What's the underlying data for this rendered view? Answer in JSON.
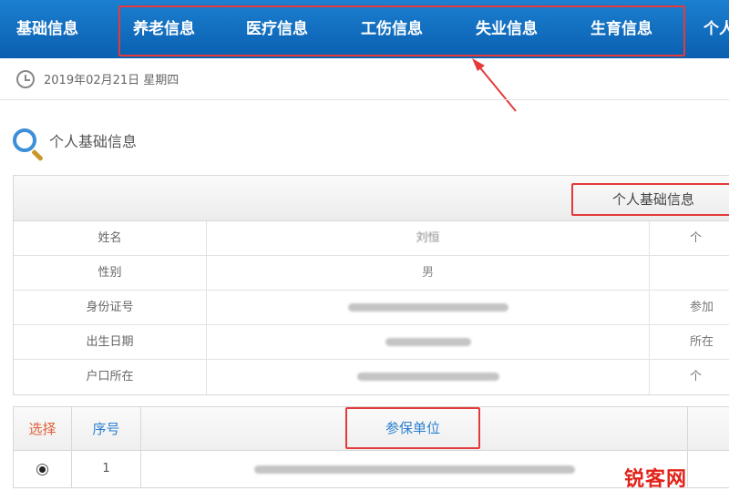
{
  "nav": {
    "items": [
      "基础信息",
      "养老信息",
      "医疗信息",
      "工伤信息",
      "失业信息",
      "生育信息",
      "个人"
    ],
    "highlight_color": "#e53a3a",
    "bar_color": "#0a5fb0"
  },
  "datebar": {
    "date_text": "2019年02月21日 星期四"
  },
  "section": {
    "title": "个人基础信息"
  },
  "info_table": {
    "header_label": "个人基础信息",
    "rows": [
      {
        "label": "姓名",
        "value": "刘恒",
        "extra": "个"
      },
      {
        "label": "性别",
        "value": "男",
        "extra": ""
      },
      {
        "label": "身份证号",
        "value": "",
        "extra": "参加"
      },
      {
        "label": "出生日期",
        "value": "",
        "extra": "所在"
      },
      {
        "label": "户口所在",
        "value": "",
        "extra": "个"
      }
    ]
  },
  "units_table": {
    "headers": {
      "select": "选择",
      "seq": "序号",
      "unit": "参保单位"
    },
    "rows": [
      {
        "seq": "1"
      }
    ]
  },
  "watermark": {
    "text": "锐客网"
  }
}
